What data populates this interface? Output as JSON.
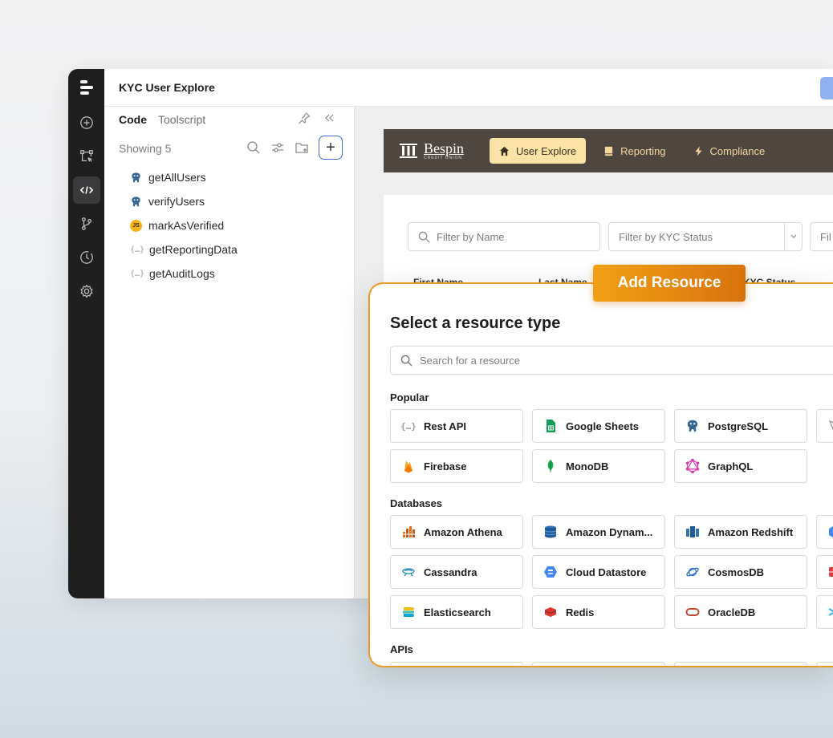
{
  "app": {
    "title": "KYC User Explore"
  },
  "sidebar": {
    "tabs": [
      {
        "label": "Code"
      },
      {
        "label": "Toolscript"
      }
    ],
    "showing": "Showing 5",
    "queries": [
      {
        "label": "getAllUsers",
        "icon": "postgres-icon"
      },
      {
        "label": "verifyUsers",
        "icon": "postgres-icon"
      },
      {
        "label": "markAsVerified",
        "icon": "javascript-icon",
        "badge": "JS"
      },
      {
        "label": "getReportingData",
        "icon": "rest-api-icon"
      },
      {
        "label": "getAuditLogs",
        "icon": "rest-api-icon"
      }
    ]
  },
  "app_preview": {
    "brand": {
      "name": "Bespin",
      "subtitle": "CREDIT UNION"
    },
    "nav": [
      {
        "label": "User Explore",
        "icon": "home-icon",
        "active": true
      },
      {
        "label": "Reporting",
        "icon": "book-icon",
        "active": false
      },
      {
        "label": "Compliance",
        "icon": "bolt-icon",
        "active": false
      }
    ],
    "filters": {
      "name_placeholder": "Filter by Name",
      "status_placeholder": "Filter by KYC Status",
      "third_placeholder": "Fil"
    },
    "columns": [
      "First Name",
      "Last Name",
      "KYC Status"
    ]
  },
  "callout": {
    "label": "Add Resource"
  },
  "modal": {
    "title": "Select a resource type",
    "search_placeholder": "Search for a resource",
    "sections": {
      "popular": "Popular",
      "databases": "Databases",
      "apis": "APIs"
    },
    "popular": [
      {
        "label": "Rest API",
        "icon": "rest-api-icon"
      },
      {
        "label": "Google Sheets",
        "icon": "google-sheets-icon"
      },
      {
        "label": "PostgreSQL",
        "icon": "postgres-icon"
      },
      {
        "label": "Firebase",
        "icon": "firebase-icon"
      },
      {
        "label": "MonoDB",
        "icon": "mongodb-icon"
      },
      {
        "label": "GraphQL",
        "icon": "graphql-icon"
      }
    ],
    "databases": [
      {
        "label": "Amazon Athena",
        "icon": "amazon-athena-icon"
      },
      {
        "label": "Amazon Dynam...",
        "icon": "amazon-dynamodb-icon"
      },
      {
        "label": "Amazon Redshift",
        "icon": "amazon-redshift-icon"
      },
      {
        "label": "Cassandra",
        "icon": "cassandra-icon"
      },
      {
        "label": "Cloud Datastore",
        "icon": "cloud-datastore-icon"
      },
      {
        "label": "CosmosDB",
        "icon": "cosmosdb-icon"
      },
      {
        "label": "Elasticsearch",
        "icon": "elasticsearch-icon"
      },
      {
        "label": "Redis",
        "icon": "redis-icon"
      },
      {
        "label": "OracleDB",
        "icon": "oracledb-icon"
      }
    ]
  }
}
